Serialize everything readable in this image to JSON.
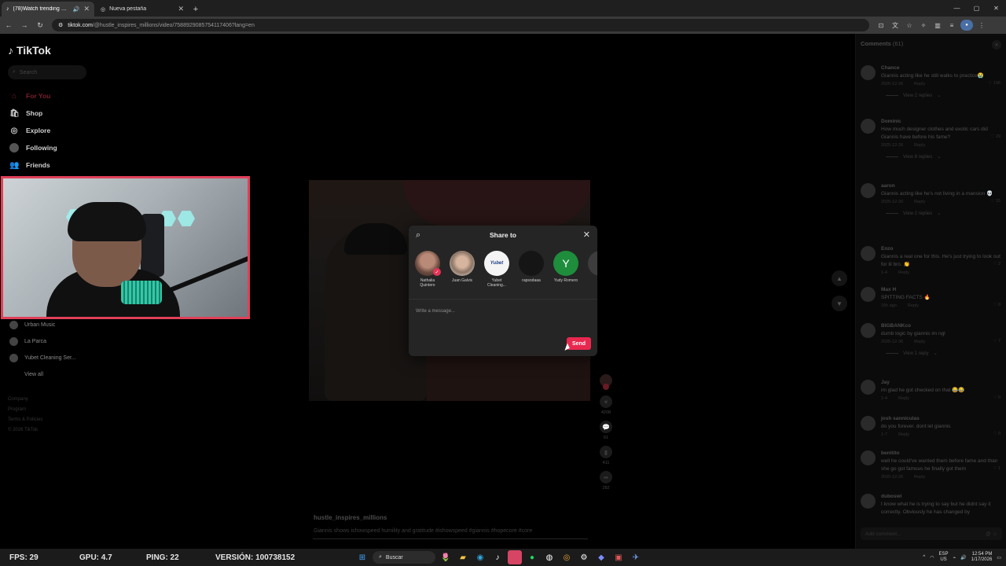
{
  "browser": {
    "tabs": [
      {
        "title": "(78)Watch trending videos",
        "active": true
      },
      {
        "title": "Nueva pestaña",
        "active": false
      }
    ],
    "url_host": "tiktok.com",
    "url_path": "/@hustle_inspires_millions/video/7588929085754117406?lang=en"
  },
  "tiktok": {
    "logo": "TikTok",
    "search_placeholder": "Search",
    "nav": [
      {
        "label": "For You",
        "icon": "home-icon",
        "active": true
      },
      {
        "label": "Shop",
        "icon": "shop-icon",
        "active": false
      },
      {
        "label": "Explore",
        "icon": "compass-icon",
        "active": false
      },
      {
        "label": "Following",
        "icon": "avatar-icon",
        "active": false
      },
      {
        "label": "Friends",
        "icon": "friends-icon",
        "active": false
      }
    ],
    "following": [
      "Urban Music",
      "La Parca",
      "Yubet Cleaning Ser..."
    ],
    "view_all": "View all",
    "footer": [
      "Company",
      "Program",
      "Terms & Policies",
      "© 2026 TikTok"
    ],
    "caption_user": "hustle_inspires_millions",
    "caption_text": "Giannis shows ishowspeed humility and gratitude #ishowspeed #giannis #hopecore #core"
  },
  "share": {
    "title": "Share to",
    "contacts": [
      {
        "name": "Nathalia Quintero",
        "avatar": "photo1",
        "initial": "",
        "badge": true
      },
      {
        "name": "Juan Galvis",
        "avatar": "photo2",
        "initial": "",
        "badge": false
      },
      {
        "name": "Yubet Cleaning...",
        "avatar": "white",
        "initial": "Yubet",
        "badge": false
      },
      {
        "name": "rapsodaaa",
        "avatar": "blank",
        "initial": "",
        "badge": false
      },
      {
        "name": "Yudy Romero",
        "avatar": "green",
        "initial": "Y",
        "badge": false
      },
      {
        "name": "Or",
        "avatar": "faded",
        "initial": "",
        "badge": false
      }
    ],
    "message_placeholder": "Write a message...",
    "send": "Send"
  },
  "rail": [
    {
      "icon": "avatar-icon",
      "count": ""
    },
    {
      "icon": "heart-icon",
      "count": "4208"
    },
    {
      "icon": "comment-icon",
      "count": "61"
    },
    {
      "icon": "bookmark-icon",
      "count": "411"
    },
    {
      "icon": "share-icon",
      "count": "282"
    }
  ],
  "comments_panel": {
    "title": "Comments",
    "count": "(61)",
    "add_placeholder": "Add comment...",
    "items": [
      {
        "user": "Chance",
        "text": "Giannis acting like he still walks to practice😭",
        "date": "2025-12-26",
        "likes": "196",
        "replies": "View 2 replies"
      },
      {
        "user": "Dominic",
        "text": "How much designer clothes and exotic cars did Giannis have before his fame?",
        "date": "2025-12-26",
        "likes": "29",
        "replies": "View 8 replies"
      },
      {
        "user": "aaron",
        "text": "Giannis acting like he's not living in a mansion 💀",
        "date": "2025-12-30",
        "likes": "15",
        "replies": "View 2 replies"
      },
      {
        "user": "Enzo",
        "text": "Giannis a real one for this. He's just trying to look out for lil bro. 👏",
        "date": "1-4",
        "likes": "2",
        "replies": ""
      },
      {
        "user": "Max H",
        "text": "SPITTING FACTS 🔥",
        "date": "15h ago",
        "likes": "0",
        "replies": ""
      },
      {
        "user": "BIGBANKco",
        "text": "dumb logic by giannis im ngl",
        "date": "2025-12-30",
        "likes": "7",
        "replies": "View 1 reply"
      },
      {
        "user": "Jay",
        "text": "im glad he got checked on that 😂😂",
        "date": "1-4",
        "likes": "0",
        "replies": ""
      },
      {
        "user": "josh sanniculas",
        "text": "do you forever. dont let giannis",
        "date": "1-7",
        "likes": "0",
        "replies": ""
      },
      {
        "user": "benitito",
        "text": "well he could've wanted them before fame and than she go got famous he finally got them",
        "date": "2025-12-26",
        "likes": "1",
        "replies": ""
      },
      {
        "user": "duboswi",
        "text": "I know what he is trying to say but he didnt say it correctly. Obviously he has changed by",
        "date": "",
        "likes": "",
        "replies": ""
      }
    ],
    "reply_label": "Reply"
  },
  "overlay_stats": {
    "fps": "FPS: 29",
    "gpu": "GPU: 4.7",
    "ping": "PING: 22",
    "version": "VERSIÓN: 100738152"
  },
  "taskbar": {
    "search": "Buscar",
    "lang_top": "ESP",
    "lang_bottom": "US",
    "time": "12:54 PM",
    "date": "1/17/2026"
  }
}
